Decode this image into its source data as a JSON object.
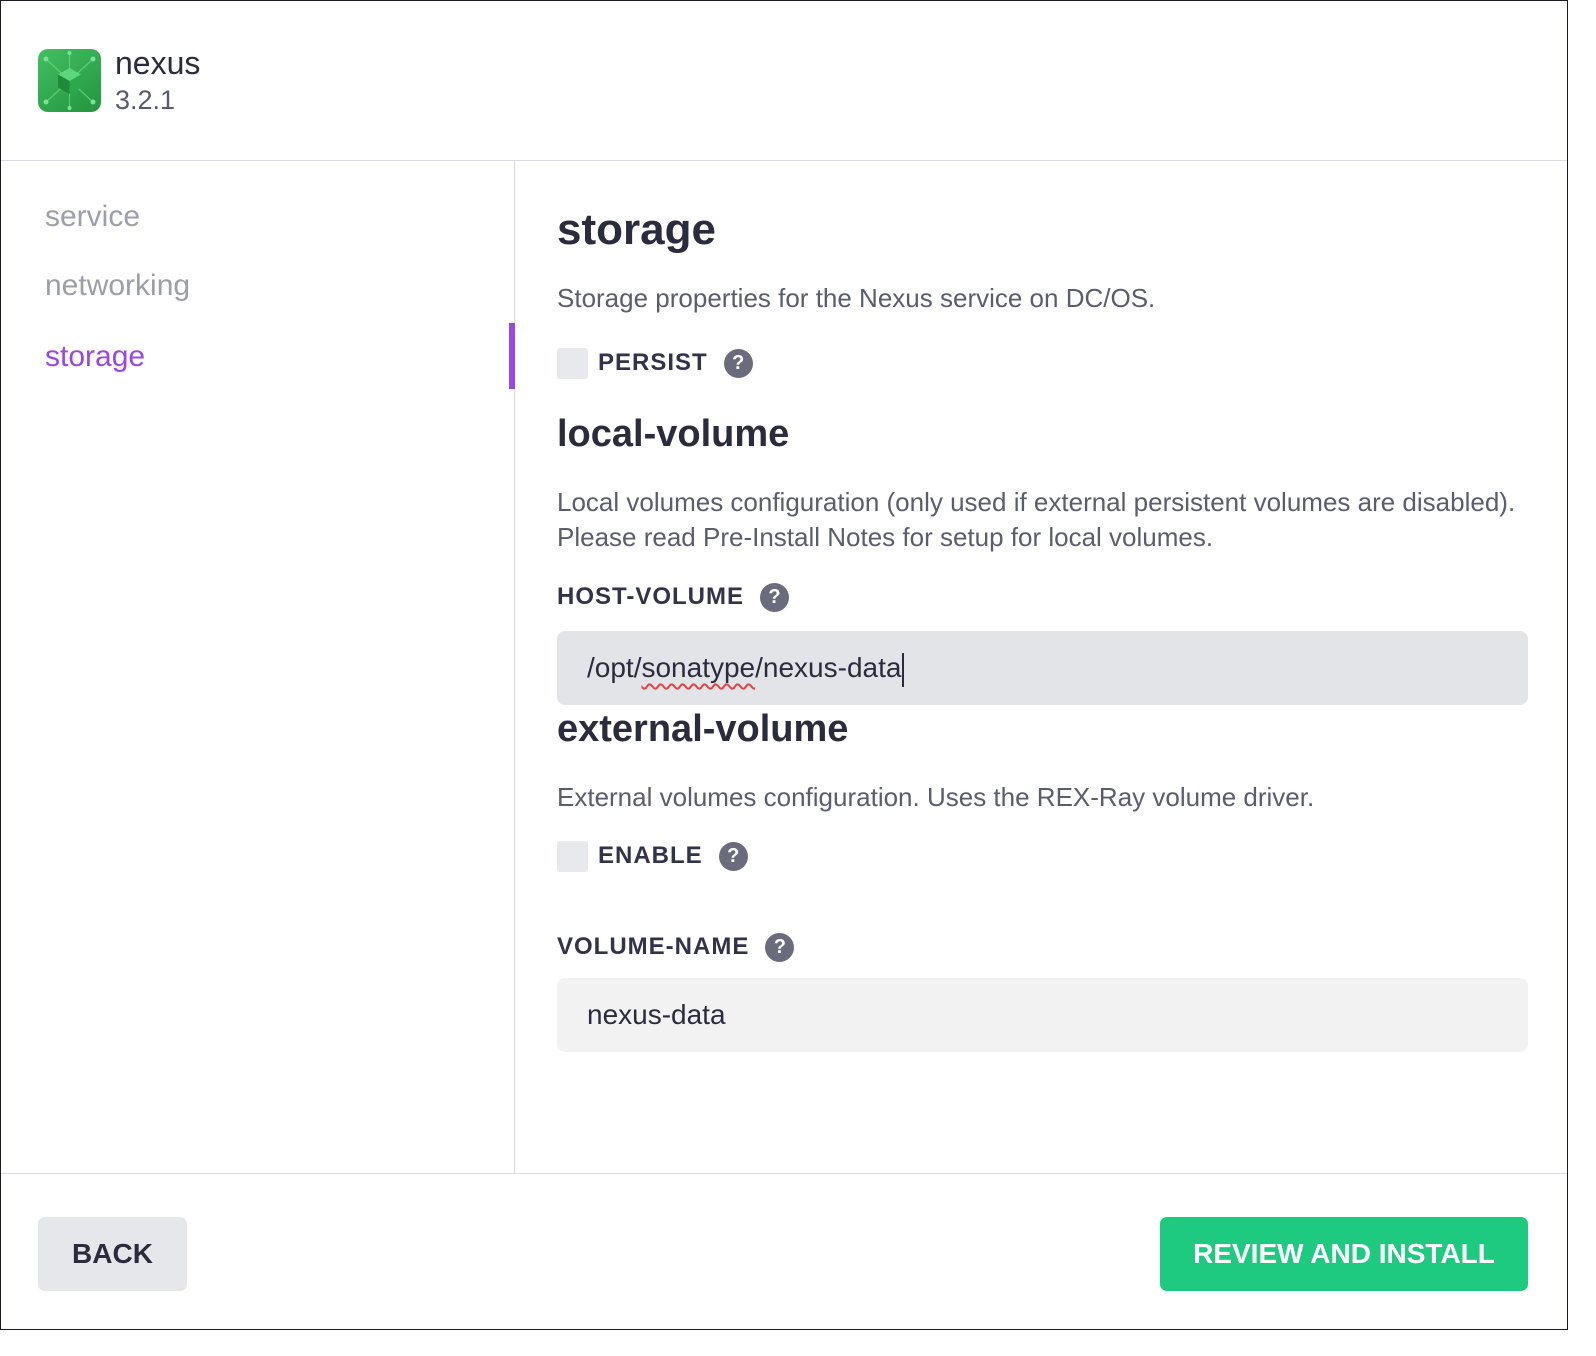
{
  "app": {
    "name": "nexus",
    "version": "3.2.1",
    "icon": "nexus-cube-icon",
    "icon_color": "#2fa84f"
  },
  "sidebar": {
    "items": [
      {
        "label": "service",
        "active": false
      },
      {
        "label": "networking",
        "active": false
      },
      {
        "label": "storage",
        "active": true
      }
    ],
    "active_color": "#9b47e3"
  },
  "main": {
    "title": "storage",
    "description": "Storage properties for the Nexus service on DC/OS.",
    "persist": {
      "label": "PERSIST",
      "checked": false,
      "help": "?"
    },
    "local_volume": {
      "title": "local-volume",
      "description": "Local volumes configuration (only used if external persistent volumes are disabled). Please read Pre-Install Notes for setup for local volumes.",
      "host_volume": {
        "label": "HOST-VOLUME",
        "help": "?",
        "value_prefix": "/opt/",
        "value_misspelled": "sonatype",
        "value_suffix": "/nexus-data"
      }
    },
    "external_volume": {
      "title": "external-volume",
      "description": "External volumes configuration. Uses the REX-Ray volume driver.",
      "enable": {
        "label": "ENABLE",
        "checked": false,
        "help": "?"
      },
      "volume_name": {
        "label": "VOLUME-NAME",
        "help": "?",
        "value": "nexus-data"
      }
    }
  },
  "footer": {
    "back_label": "BACK",
    "primary_label": "REVIEW AND INSTALL",
    "primary_color": "#1ec980"
  }
}
